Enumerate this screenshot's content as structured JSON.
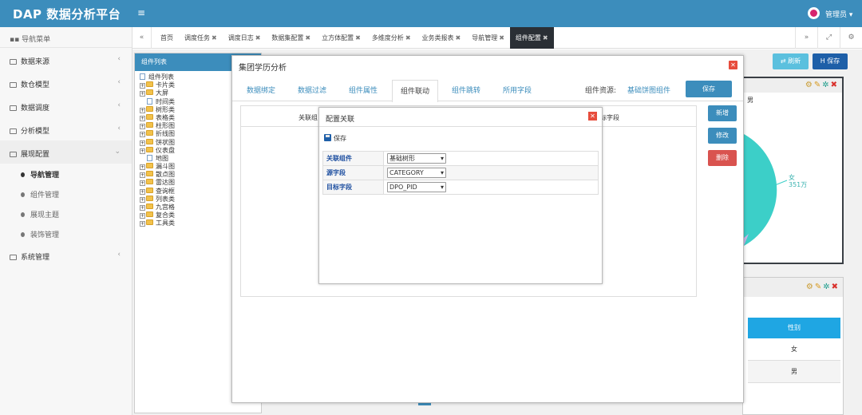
{
  "app": {
    "title": "DAP 数据分析平台",
    "user": "管理员 ▾"
  },
  "sidebar": {
    "header": "导航菜单",
    "items": [
      {
        "label": "数据来源"
      },
      {
        "label": "数仓模型"
      },
      {
        "label": "数据调度"
      },
      {
        "label": "分析模型"
      },
      {
        "label": "展现配置",
        "open": true
      },
      {
        "label": "系统管理"
      }
    ],
    "subitems": [
      {
        "label": "导航管理",
        "active": true
      },
      {
        "label": "组件管理"
      },
      {
        "label": "展现主题"
      },
      {
        "label": "装饰管理"
      }
    ]
  },
  "tabs": [
    {
      "label": "首页"
    },
    {
      "label": "调度任务",
      "closable": true
    },
    {
      "label": "调度日志",
      "closable": true
    },
    {
      "label": "数据集配置",
      "closable": true
    },
    {
      "label": "立方体配置",
      "closable": true
    },
    {
      "label": "多维度分析",
      "closable": true
    },
    {
      "label": "业务类报表",
      "closable": true
    },
    {
      "label": "导航管理",
      "closable": true
    },
    {
      "label": "组件配置",
      "closable": true,
      "active": true
    }
  ],
  "toolbar": {
    "refresh": "⇄ 刷新",
    "save": "H 保存"
  },
  "component_list": {
    "header": "组件列表",
    "root": "组件列表",
    "nodes": [
      {
        "label": "卡片类",
        "type": "folder"
      },
      {
        "label": "大屏",
        "type": "folder"
      },
      {
        "label": "时间类",
        "type": "leaf"
      },
      {
        "label": "树形类",
        "type": "folder"
      },
      {
        "label": "表格类",
        "type": "folder"
      },
      {
        "label": "柱形图",
        "type": "folder"
      },
      {
        "label": "折线图",
        "type": "folder"
      },
      {
        "label": "饼状图",
        "type": "folder"
      },
      {
        "label": "仪表盘",
        "type": "folder"
      },
      {
        "label": "地图",
        "type": "leaf"
      },
      {
        "label": "漏斗图",
        "type": "folder"
      },
      {
        "label": "散点图",
        "type": "folder"
      },
      {
        "label": "雷达图",
        "type": "folder"
      },
      {
        "label": "查询框",
        "type": "folder"
      },
      {
        "label": "列表类",
        "type": "folder"
      },
      {
        "label": "九宫格",
        "type": "folder"
      },
      {
        "label": "复合类",
        "type": "folder"
      },
      {
        "label": "工具类",
        "type": "folder"
      }
    ]
  },
  "bg_chart": {
    "legend": "男",
    "slice_label": "女",
    "slice_value": "351万",
    "colors": {
      "female": "#3ccfc8",
      "other": "#c8b6e8"
    }
  },
  "bg_table": {
    "header": "性别",
    "rows": [
      "女",
      "男"
    ]
  },
  "dialog": {
    "title": "集团学历分析",
    "tabs": [
      {
        "label": "数据绑定"
      },
      {
        "label": "数据过滤"
      },
      {
        "label": "组件属性"
      },
      {
        "label": "组件联动",
        "active": true
      },
      {
        "label": "组件跳转"
      },
      {
        "label": "所用字段"
      }
    ],
    "source_label": "组件资源:",
    "source_value": "基础饼图组件",
    "save": "保存",
    "col_assoc": "关联组",
    "col_target": "标字段",
    "buttons": {
      "add": "新增",
      "edit": "修改",
      "delete": "删除"
    },
    "colors": {
      "primary": "#3c8dbc",
      "danger": "#d9534f"
    }
  },
  "config": {
    "title": "配置关联",
    "save": "保存",
    "rows": [
      {
        "label": "关联组件",
        "value": "基础树形"
      },
      {
        "label": "源字段",
        "value": "CATEGORY"
      },
      {
        "label": "目标字段",
        "value": "DPO_PID"
      }
    ]
  }
}
